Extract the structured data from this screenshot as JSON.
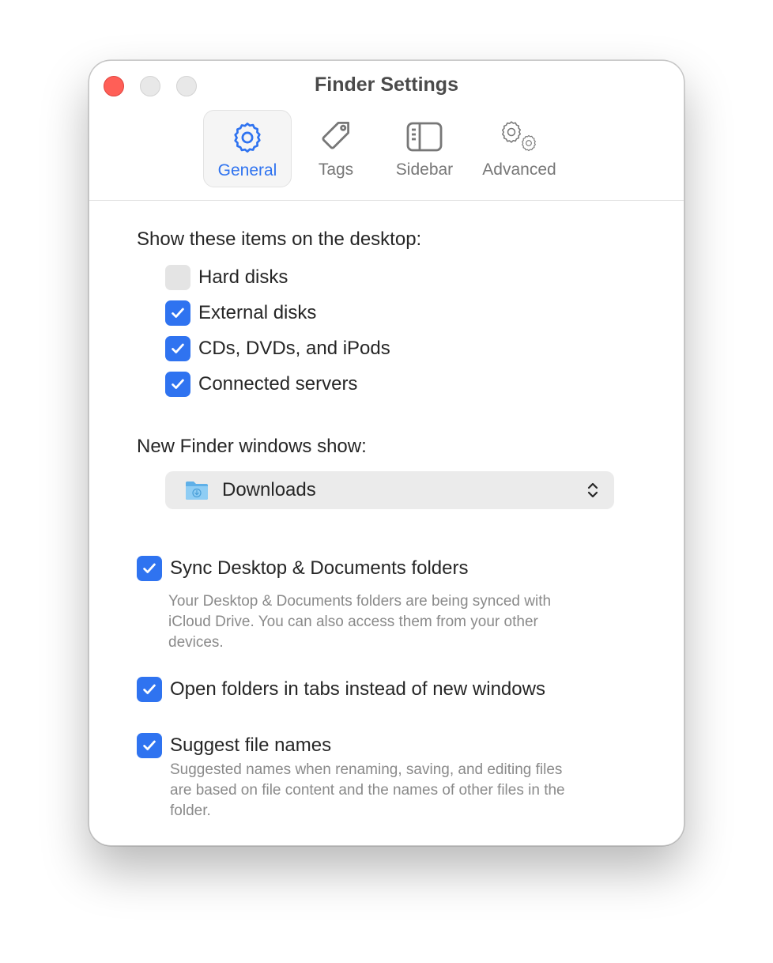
{
  "window": {
    "title": "Finder Settings"
  },
  "tabs": [
    {
      "label": "General",
      "icon": "gear-icon",
      "selected": true
    },
    {
      "label": "Tags",
      "icon": "tag-icon",
      "selected": false
    },
    {
      "label": "Sidebar",
      "icon": "sidebar-icon",
      "selected": false
    },
    {
      "label": "Advanced",
      "icon": "gears-icon",
      "selected": false
    }
  ],
  "desktop": {
    "heading": "Show these items on the desktop:",
    "items": [
      {
        "label": "Hard disks",
        "checked": false
      },
      {
        "label": "External disks",
        "checked": true
      },
      {
        "label": "CDs, DVDs, and iPods",
        "checked": true
      },
      {
        "label": "Connected servers",
        "checked": true
      }
    ]
  },
  "new_window": {
    "heading": "New Finder windows show:",
    "selected": "Downloads",
    "icon": "downloads-folder-icon"
  },
  "options": [
    {
      "label": "Sync Desktop & Documents folders",
      "checked": true,
      "desc_lines": [
        "Your Desktop & Documents folders are being synced with",
        "iCloud Drive. You can also access them from your other",
        "devices."
      ]
    },
    {
      "label": "Open folders in tabs instead of new windows",
      "checked": true,
      "desc_lines": []
    },
    {
      "label": "Suggest file names",
      "checked": true,
      "desc_lines": [
        "Suggested names when renaming, saving, and editing files",
        "are based on file content and the names of other files in the",
        "folder."
      ]
    }
  ],
  "colors": {
    "accent": "#2f73f0",
    "close": "#ff5f57"
  }
}
